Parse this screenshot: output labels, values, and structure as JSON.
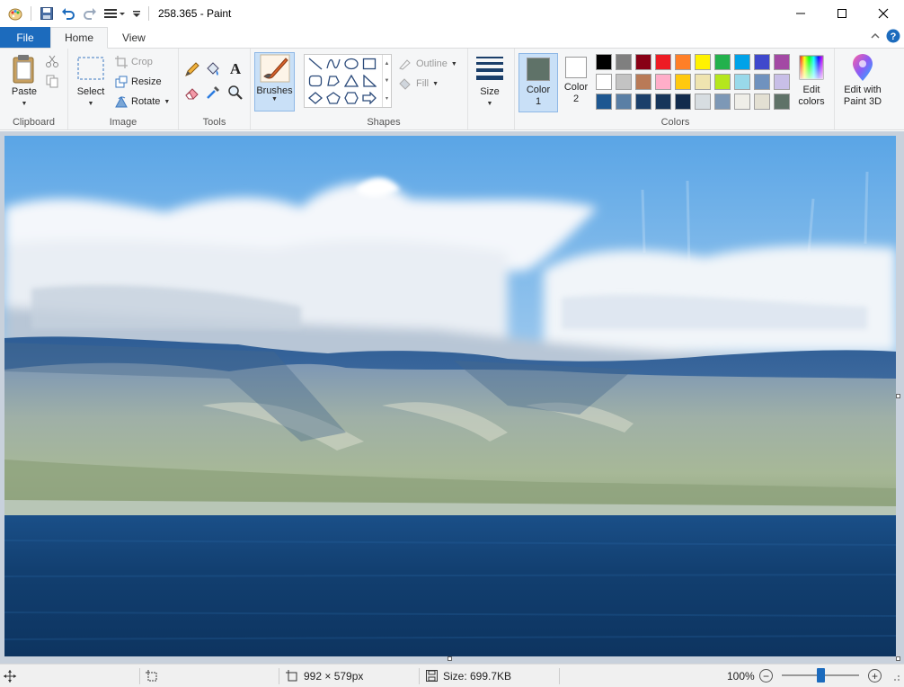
{
  "window": {
    "title": "258.365 - Paint",
    "controls": [
      "minimize",
      "maximize",
      "close"
    ]
  },
  "qat": {
    "icons": [
      "paint-app-icon",
      "save-icon",
      "undo-icon",
      "redo-icon",
      "customize-icon"
    ]
  },
  "tabs": [
    {
      "label": "File"
    },
    {
      "label": "Home"
    },
    {
      "label": "View"
    }
  ],
  "ribbon": {
    "clipboard": {
      "group_label": "Clipboard",
      "paste": "Paste"
    },
    "image": {
      "group_label": "Image",
      "select": "Select",
      "crop": "Crop",
      "resize": "Resize",
      "rotate": "Rotate"
    },
    "tools": {
      "group_label": "Tools"
    },
    "brushes": {
      "label": "Brushes"
    },
    "shapes": {
      "group_label": "Shapes",
      "outline": "Outline",
      "fill": "Fill"
    },
    "size": {
      "label": "Size"
    },
    "colors": {
      "group_label": "Colors",
      "color1_label_line1": "Color",
      "color1_label_line2": "1",
      "color1_value": "#5f7268",
      "color2_label_line1": "Color",
      "color2_label_line2": "2",
      "color2_value": "#ffffff",
      "edit_colors_line1": "Edit",
      "edit_colors_line2": "colors",
      "palette": [
        [
          "#000000",
          "#7f7f7f",
          "#880015",
          "#ed1c24",
          "#ff7f27",
          "#fff200",
          "#22b14c",
          "#00a2e8",
          "#3f48cc",
          "#a349a4"
        ],
        [
          "#ffffff",
          "#c3c3c3",
          "#b97a57",
          "#ffaec9",
          "#ffc90e",
          "#efe4b0",
          "#b5e61d",
          "#99d9ea",
          "#7092be",
          "#c8bfe7"
        ],
        [
          "#1d5791",
          "#5a7fa5",
          "#1b3f6a",
          "#16355a",
          "#122b4c",
          "#d7dde1",
          "#7d98b6",
          "#efeee8",
          "#e3e0d3",
          "#5f7268"
        ]
      ]
    },
    "paint3d": {
      "label_line1": "Edit with",
      "label_line2": "Paint 3D"
    }
  },
  "status": {
    "dimensions": "992 × 579px",
    "size": "Size: 699.7KB",
    "zoom": "100%",
    "zoom_level_fraction": 0.5
  }
}
